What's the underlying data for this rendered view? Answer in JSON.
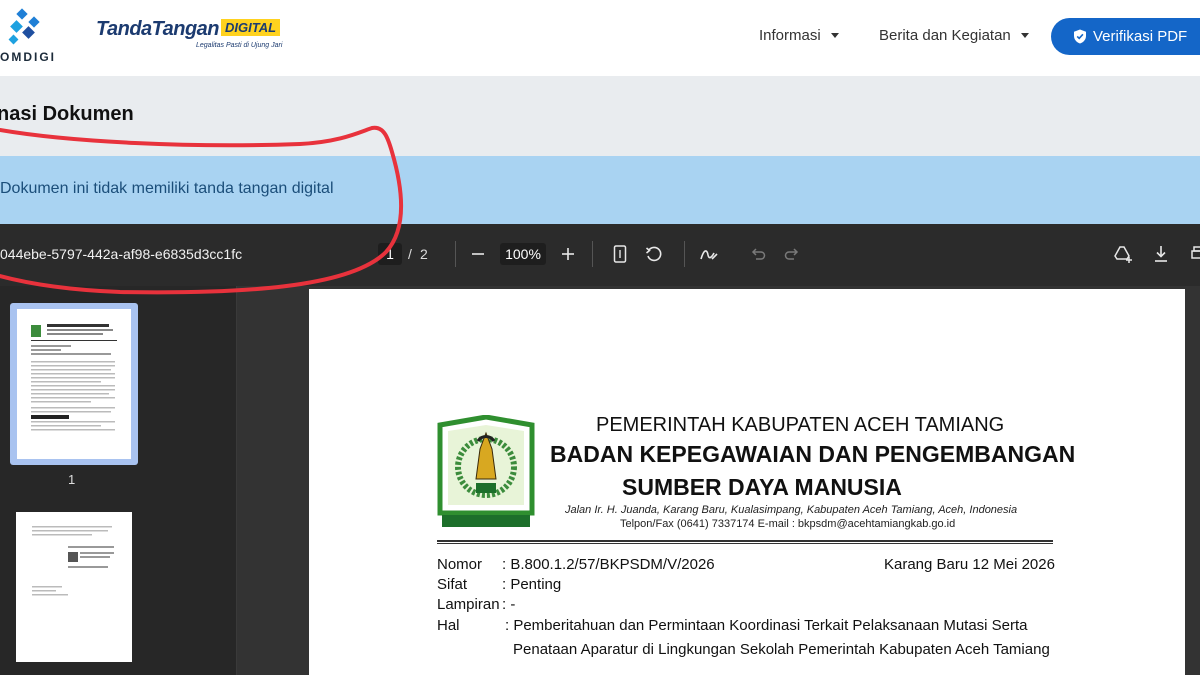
{
  "header": {
    "komdigi_text": "OMDIGI",
    "brand_main": "TandaTangan",
    "brand_digital": "DIGITAL",
    "brand_tagline": "Legalitas Pasti di Ujung Jari",
    "nav": [
      {
        "label": "Informasi"
      },
      {
        "label": "Berita dan Kegiatan"
      }
    ],
    "verify_button": "Verifikasi PDF"
  },
  "page_title": "nasi Dokumen",
  "alert": {
    "message": "Dokumen ini tidak memiliki tanda tangan digital"
  },
  "viewer": {
    "document_name": "044ebe-5797-442a-af98-e6835d3cc1fc",
    "current_page": "1",
    "page_separator": "/",
    "total_pages": "2",
    "zoom": "100%",
    "thumbnails": [
      {
        "label": "1"
      },
      {
        "label": ""
      }
    ]
  },
  "letter": {
    "government": "PEMERINTAH KABUPATEN ACEH TAMIANG",
    "agency_line1": "BADAN KEPEGAWAIAN DAN PENGEMBANGAN",
    "agency_line2": "SUMBER DAYA MANUSIA",
    "address": "Jalan Ir. H. Juanda, Karang Baru, Kualasimpang, Kabupaten Aceh Tamiang, Aceh, Indonesia",
    "contact": "Telpon/Fax (0641) 7337174 E-mail : bkpsdm@acehtamiangkab.go.id",
    "emblem_motto": "SATYA PADU SETIA BAKTI",
    "nomor_label": "Nomor",
    "nomor_value": ": B.800.1.2/57/BKPSDM/V/2026",
    "date": "Karang Baru 12 Mei 2026",
    "sifat_label": "Sifat",
    "sifat_value": ": Penting",
    "lampiran_label": "Lampiran",
    "lampiran_value": ": -",
    "hal_label": "Hal",
    "hal_value_line1": ": Pemberitahuan dan Permintaan Koordinasi Terkait Pelaksanaan Mutasi Serta",
    "hal_value_line2": "Penataan Aparatur di Lingkungan Sekolah Pemerintah Kabupaten Aceh Tamiang"
  },
  "colors": {
    "primary": "#1466c8",
    "alert_bg": "#a9d3f2",
    "annotation": "#e8323c",
    "toolbar_bg": "#2b2b2b"
  }
}
